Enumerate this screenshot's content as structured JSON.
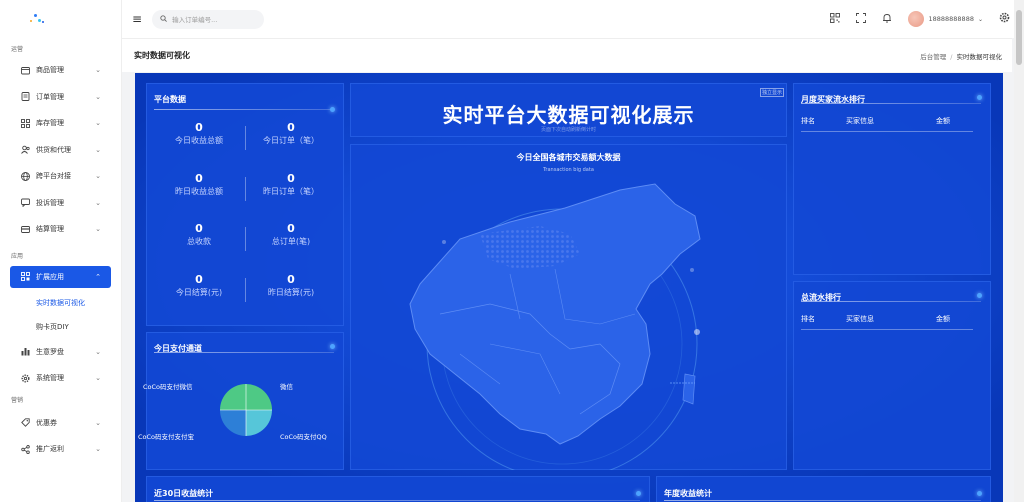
{
  "sidebar": {
    "sections": {
      "ops": "运营",
      "app": "应用",
      "marketing": "营销"
    },
    "items_ops": [
      {
        "label": "商品管理",
        "icon": "product-icon"
      },
      {
        "label": "订单管理",
        "icon": "order-icon"
      },
      {
        "label": "库存管理",
        "icon": "inventory-icon"
      },
      {
        "label": "供货和代理",
        "icon": "supplier-icon"
      },
      {
        "label": "跨平台对接",
        "icon": "globe-icon"
      },
      {
        "label": "投诉管理",
        "icon": "complaint-icon"
      },
      {
        "label": "结算管理",
        "icon": "settlement-icon"
      }
    ],
    "items_app": {
      "extended": {
        "label": "扩展应用",
        "icon": "grid-icon"
      },
      "sub": [
        "实时数据可视化",
        "购卡页DIY"
      ],
      "rest": [
        {
          "label": "生意罗盘",
          "icon": "bar-chart-icon"
        },
        {
          "label": "系统管理",
          "icon": "gear-icon"
        }
      ]
    },
    "items_marketing": [
      {
        "label": "优惠券",
        "icon": "coupon-icon"
      },
      {
        "label": "推广返利",
        "icon": "share-icon"
      }
    ]
  },
  "topbar": {
    "search_placeholder": "输入订单编号...",
    "username": "18888888888"
  },
  "page": {
    "title": "实时数据可视化",
    "breadcrumb": [
      "后台管理",
      "实时数据可视化"
    ]
  },
  "dashboard": {
    "platform_panel_title": "平台数据",
    "stats": [
      {
        "value": "0",
        "label": "今日收益总额"
      },
      {
        "value": "0",
        "label": "今日订单（笔）"
      },
      {
        "value": "0",
        "label": "昨日收益总额"
      },
      {
        "value": "0",
        "label": "昨日订单（笔）"
      },
      {
        "value": "0",
        "label": "总收款"
      },
      {
        "value": "0",
        "label": "总订单(笔)"
      },
      {
        "value": "0",
        "label": "今日结算(元)"
      },
      {
        "value": "0",
        "label": "昨日结算(元)"
      }
    ],
    "big_title": "实时平台大数据可视化展示",
    "big_subtitle": "页面下次自动刷新倒计时",
    "independent_label": "独立显示",
    "map_title": "今日全国各城市交易额大数据",
    "map_subtitle": "Transaction big data",
    "monthly_rank_title": "月度买家流水排行",
    "total_rank_title": "总流水排行",
    "rank_columns": [
      "排名",
      "买家信息",
      "金额"
    ],
    "payment_title": "今日支付通道",
    "payment_legend": [
      "CoCo码支付微信",
      "微信",
      "CoCo码支付支付宝",
      "CoCo码支付QQ"
    ],
    "payment_colors": [
      "#4ec985",
      "#56c6d9",
      "#2d7fd7",
      "#3a6fe0"
    ],
    "bottom_left_title": "近30日收益统计",
    "bottom_right_title": "年度收益统计"
  }
}
